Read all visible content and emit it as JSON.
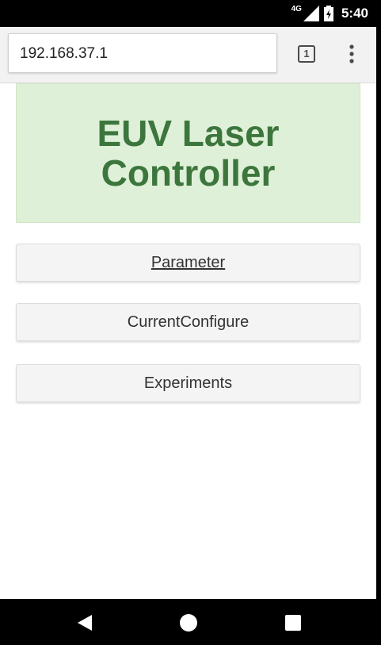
{
  "status_bar": {
    "network_label": "4G",
    "time": "5:40"
  },
  "browser": {
    "url": "192.168.37.1",
    "tab_count": "1"
  },
  "page": {
    "title": "EUV Laser Controller",
    "buttons": [
      {
        "label": "Parameter"
      },
      {
        "label": "CurrentConfigure"
      },
      {
        "label": "Experiments"
      }
    ]
  },
  "colors": {
    "hero_background": "#dff0d8",
    "hero_text": "#3c763d",
    "button_background": "#f4f4f4"
  },
  "icons": [
    "signal-icon",
    "battery-icon",
    "overflow-menu-icon",
    "back-icon",
    "home-icon",
    "recents-icon"
  ]
}
